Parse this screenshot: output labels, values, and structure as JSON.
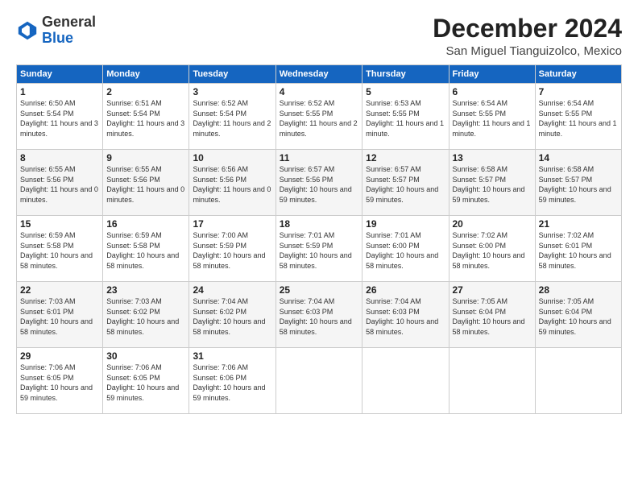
{
  "header": {
    "logo": {
      "general": "General",
      "blue": "Blue"
    },
    "title": "December 2024",
    "location": "San Miguel Tianguizolco, Mexico"
  },
  "days_of_week": [
    "Sunday",
    "Monday",
    "Tuesday",
    "Wednesday",
    "Thursday",
    "Friday",
    "Saturday"
  ],
  "weeks": [
    [
      {
        "day": "1",
        "info": "Sunrise: 6:50 AM\nSunset: 5:54 PM\nDaylight: 11 hours and 3 minutes."
      },
      {
        "day": "2",
        "info": "Sunrise: 6:51 AM\nSunset: 5:54 PM\nDaylight: 11 hours and 3 minutes."
      },
      {
        "day": "3",
        "info": "Sunrise: 6:52 AM\nSunset: 5:54 PM\nDaylight: 11 hours and 2 minutes."
      },
      {
        "day": "4",
        "info": "Sunrise: 6:52 AM\nSunset: 5:55 PM\nDaylight: 11 hours and 2 minutes."
      },
      {
        "day": "5",
        "info": "Sunrise: 6:53 AM\nSunset: 5:55 PM\nDaylight: 11 hours and 1 minute."
      },
      {
        "day": "6",
        "info": "Sunrise: 6:54 AM\nSunset: 5:55 PM\nDaylight: 11 hours and 1 minute."
      },
      {
        "day": "7",
        "info": "Sunrise: 6:54 AM\nSunset: 5:55 PM\nDaylight: 11 hours and 1 minute."
      }
    ],
    [
      {
        "day": "8",
        "info": "Sunrise: 6:55 AM\nSunset: 5:56 PM\nDaylight: 11 hours and 0 minutes."
      },
      {
        "day": "9",
        "info": "Sunrise: 6:55 AM\nSunset: 5:56 PM\nDaylight: 11 hours and 0 minutes."
      },
      {
        "day": "10",
        "info": "Sunrise: 6:56 AM\nSunset: 5:56 PM\nDaylight: 11 hours and 0 minutes."
      },
      {
        "day": "11",
        "info": "Sunrise: 6:57 AM\nSunset: 5:56 PM\nDaylight: 10 hours and 59 minutes."
      },
      {
        "day": "12",
        "info": "Sunrise: 6:57 AM\nSunset: 5:57 PM\nDaylight: 10 hours and 59 minutes."
      },
      {
        "day": "13",
        "info": "Sunrise: 6:58 AM\nSunset: 5:57 PM\nDaylight: 10 hours and 59 minutes."
      },
      {
        "day": "14",
        "info": "Sunrise: 6:58 AM\nSunset: 5:57 PM\nDaylight: 10 hours and 59 minutes."
      }
    ],
    [
      {
        "day": "15",
        "info": "Sunrise: 6:59 AM\nSunset: 5:58 PM\nDaylight: 10 hours and 58 minutes."
      },
      {
        "day": "16",
        "info": "Sunrise: 6:59 AM\nSunset: 5:58 PM\nDaylight: 10 hours and 58 minutes."
      },
      {
        "day": "17",
        "info": "Sunrise: 7:00 AM\nSunset: 5:59 PM\nDaylight: 10 hours and 58 minutes."
      },
      {
        "day": "18",
        "info": "Sunrise: 7:01 AM\nSunset: 5:59 PM\nDaylight: 10 hours and 58 minutes."
      },
      {
        "day": "19",
        "info": "Sunrise: 7:01 AM\nSunset: 6:00 PM\nDaylight: 10 hours and 58 minutes."
      },
      {
        "day": "20",
        "info": "Sunrise: 7:02 AM\nSunset: 6:00 PM\nDaylight: 10 hours and 58 minutes."
      },
      {
        "day": "21",
        "info": "Sunrise: 7:02 AM\nSunset: 6:01 PM\nDaylight: 10 hours and 58 minutes."
      }
    ],
    [
      {
        "day": "22",
        "info": "Sunrise: 7:03 AM\nSunset: 6:01 PM\nDaylight: 10 hours and 58 minutes."
      },
      {
        "day": "23",
        "info": "Sunrise: 7:03 AM\nSunset: 6:02 PM\nDaylight: 10 hours and 58 minutes."
      },
      {
        "day": "24",
        "info": "Sunrise: 7:04 AM\nSunset: 6:02 PM\nDaylight: 10 hours and 58 minutes."
      },
      {
        "day": "25",
        "info": "Sunrise: 7:04 AM\nSunset: 6:03 PM\nDaylight: 10 hours and 58 minutes."
      },
      {
        "day": "26",
        "info": "Sunrise: 7:04 AM\nSunset: 6:03 PM\nDaylight: 10 hours and 58 minutes."
      },
      {
        "day": "27",
        "info": "Sunrise: 7:05 AM\nSunset: 6:04 PM\nDaylight: 10 hours and 58 minutes."
      },
      {
        "day": "28",
        "info": "Sunrise: 7:05 AM\nSunset: 6:04 PM\nDaylight: 10 hours and 59 minutes."
      }
    ],
    [
      {
        "day": "29",
        "info": "Sunrise: 7:06 AM\nSunset: 6:05 PM\nDaylight: 10 hours and 59 minutes."
      },
      {
        "day": "30",
        "info": "Sunrise: 7:06 AM\nSunset: 6:05 PM\nDaylight: 10 hours and 59 minutes."
      },
      {
        "day": "31",
        "info": "Sunrise: 7:06 AM\nSunset: 6:06 PM\nDaylight: 10 hours and 59 minutes."
      },
      {
        "day": "",
        "info": ""
      },
      {
        "day": "",
        "info": ""
      },
      {
        "day": "",
        "info": ""
      },
      {
        "day": "",
        "info": ""
      }
    ]
  ]
}
